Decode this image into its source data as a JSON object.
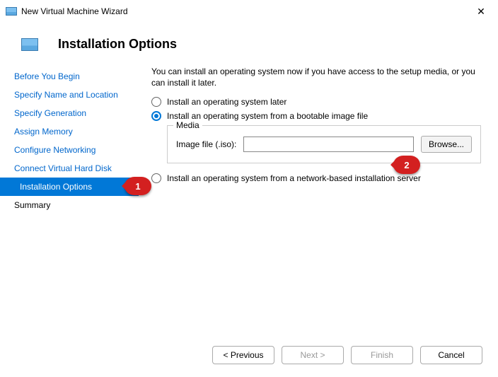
{
  "window": {
    "title": "New Virtual Machine Wizard"
  },
  "header": {
    "title": "Installation Options"
  },
  "sidebar": {
    "items": [
      {
        "label": "Before You Begin"
      },
      {
        "label": "Specify Name and Location"
      },
      {
        "label": "Specify Generation"
      },
      {
        "label": "Assign Memory"
      },
      {
        "label": "Configure Networking"
      },
      {
        "label": "Connect Virtual Hard Disk"
      },
      {
        "label": "Installation Options"
      },
      {
        "label": "Summary"
      }
    ]
  },
  "main": {
    "intro": "You can install an operating system now if you have access to the setup media, or you can install it later.",
    "option_later": "Install an operating system later",
    "option_image": "Install an operating system from a bootable image file",
    "option_network": "Install an operating system from a network-based installation server",
    "media_legend": "Media",
    "image_file_label": "Image file (.iso):",
    "image_file_value": "",
    "browse_label": "Browse..."
  },
  "footer": {
    "previous": "< Previous",
    "next": "Next >",
    "finish": "Finish",
    "cancel": "Cancel"
  },
  "callouts": {
    "one": "1",
    "two": "2"
  }
}
